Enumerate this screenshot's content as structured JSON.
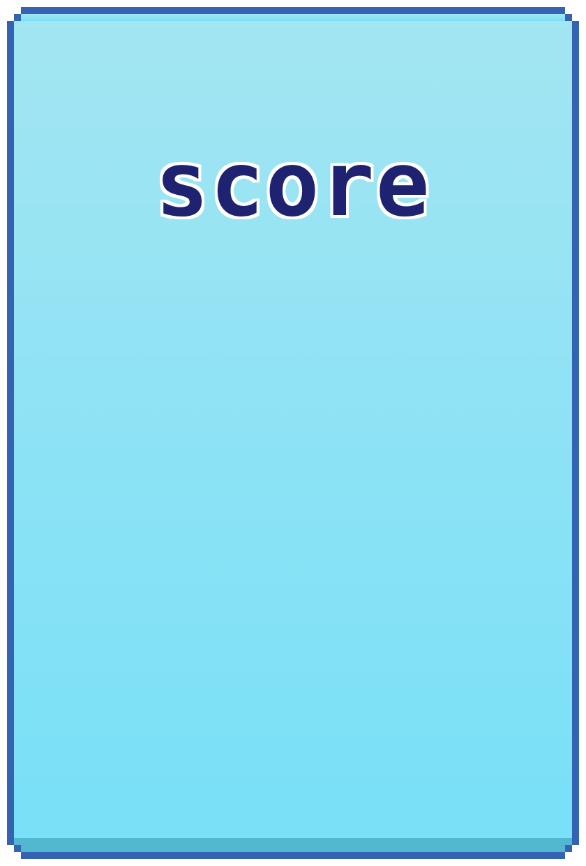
{
  "panel": {
    "title": "score",
    "colors": {
      "border": "#3463b4",
      "fill_top": "#a3e5f2",
      "fill_bottom": "#78e0f7",
      "bottom_shade": "#52b7d1",
      "title_fill": "#1e2270",
      "title_outline": "#ffffff"
    }
  }
}
